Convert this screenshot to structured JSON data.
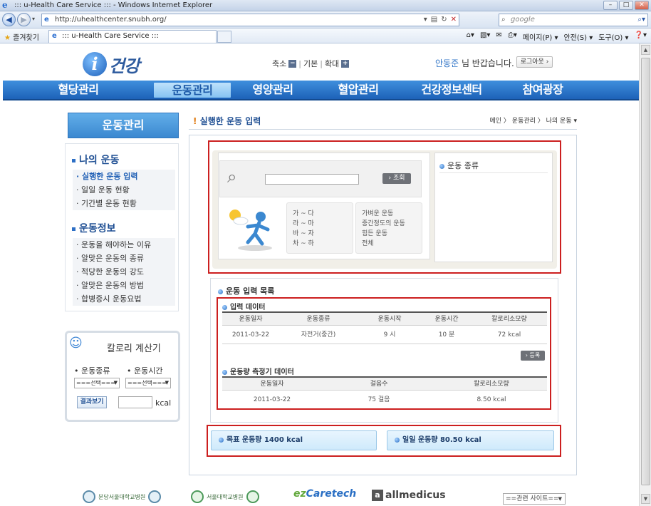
{
  "browser": {
    "title": "::: u-Health Care Service ::: - Windows Internet Explorer",
    "url": "http://uhealthcenter.snubh.org/",
    "search_placeholder": "google",
    "favorites_label": "즐겨찾기",
    "tab_title": "::: u-Health Care Service :::",
    "tools": [
      "페이지(P) ▾",
      "안전(S) ▾",
      "도구(O) ▾",
      "❓▾"
    ]
  },
  "header": {
    "logo_letter": "i",
    "logo_text": "건강",
    "zoom_out": "축소",
    "zoom_default": "기본",
    "zoom_in": "확대",
    "user_name": "안동준",
    "greeting": " 님 반갑습니다.",
    "logout": "로그아웃"
  },
  "gnb": [
    {
      "label": "혈당관리",
      "active": false
    },
    {
      "label": "운동관리",
      "active": true
    },
    {
      "label": "영양관리",
      "active": false
    },
    {
      "label": "혈압관리",
      "active": false
    },
    {
      "label": "건강정보센터",
      "active": false
    },
    {
      "label": "참여광장",
      "active": false
    }
  ],
  "sidebar": {
    "title": "운동관리",
    "group1": "나의 운동",
    "group1_items": [
      "· 실행한 운동 입력",
      "· 일일 운동 현황",
      "· 기간별 운동 현황"
    ],
    "group2": "운동정보",
    "group2_items": [
      "· 운동을 해야하는 이유",
      "· 알맞은 운동의 종류",
      "· 적당한 운동의 강도",
      "· 알맞은 운동의 방법",
      "· 합병증시 운동요법"
    ]
  },
  "calculator": {
    "title": "칼로리 계산기",
    "type_label": "• 운동종류",
    "time_label": "• 운동시간",
    "select_placeholder": "===선택===",
    "result_button": "결과보기",
    "unit": "kcal"
  },
  "main": {
    "title_mark": "!",
    "title": " 실행한 운동 입력",
    "breadcrumb": "메인  〉 운동관리  〉 나의 운동  ▾",
    "search_button": "› 조회",
    "alpha_ranges": [
      "가 ~ 다",
      "라 ~ 마",
      "바 ~ 자",
      "차 ~ 하"
    ],
    "intensity": [
      "가벼운 운동",
      "중간정도의 운동",
      "힘든 운동",
      "전체"
    ],
    "type_header": "운동 종류",
    "list_header": "운동 입력 목록",
    "input_header": "입력 데이터",
    "input_columns": [
      "운동일자",
      "운동종류",
      "운동시작",
      "운동시간",
      "칼로리소모량"
    ],
    "input_rows": [
      [
        "2011-03-22",
        "자전거(중간)",
        "9 시",
        "10 분",
        "72 kcal"
      ]
    ],
    "register_button": "› 등록",
    "meter_header": "운동량 측정기 데이터",
    "meter_columns": [
      "운동일자",
      "걸음수",
      "칼로리소모량"
    ],
    "meter_rows": [
      [
        "2011-03-22",
        "75 걸음",
        "8.50 kcal"
      ]
    ],
    "goal": "목표 운동량 1400 kcal",
    "daily": "일일 운동량 80.50 kcal"
  },
  "footer": {
    "hospital1": "분당서울대학교병원",
    "hospital2": "서울대학교병원",
    "ezcare_a": "ez",
    "ezcare_b": "Caretech",
    "allmedicus": "allmedicus",
    "related": "==관련 사이트=="
  }
}
